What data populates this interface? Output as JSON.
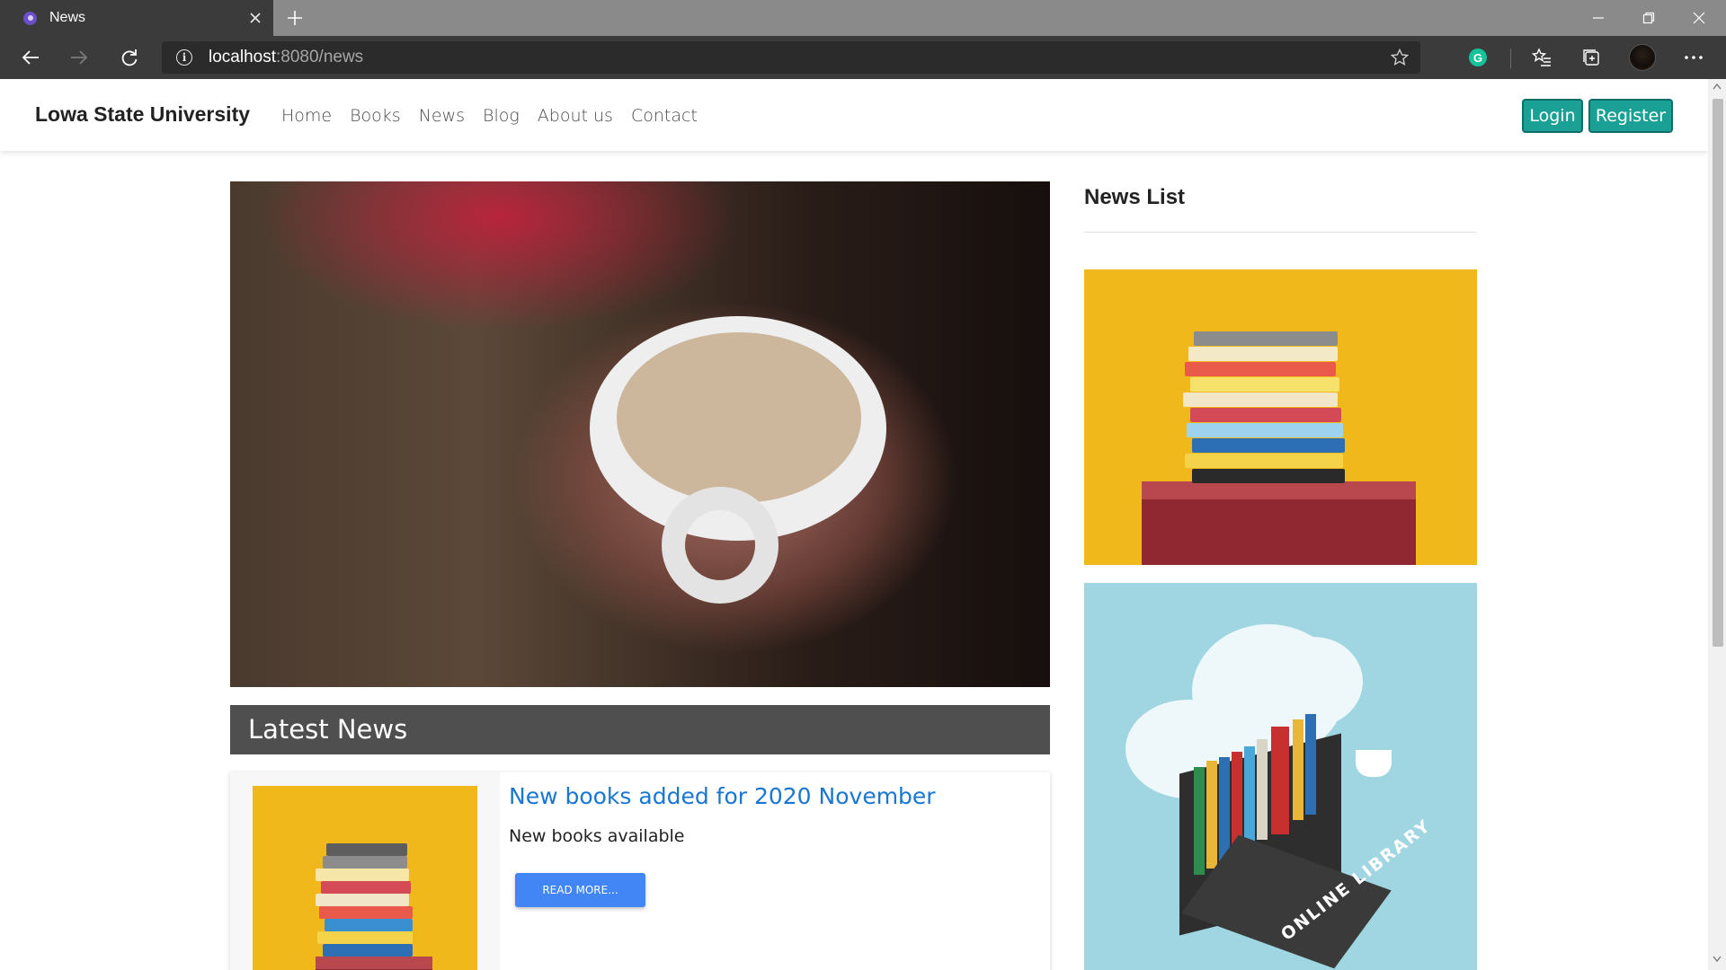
{
  "browser": {
    "tab_title": "News",
    "url_host": "localhost",
    "url_path": ":8080/news"
  },
  "site": {
    "brand": "Lowa State University",
    "menu": [
      "Home",
      "Books",
      "News",
      "Blog",
      "About us",
      "Contact"
    ],
    "login_label": "Login",
    "register_label": "Register"
  },
  "main": {
    "latest_heading": "Latest News",
    "articles": [
      {
        "headline": "New books added for 2020 November",
        "summary": "New books available",
        "read_more": "READ MORE..."
      }
    ]
  },
  "sidebar": {
    "title": "News List",
    "image2_caption": "ONLINE LIBRARY"
  },
  "colors": {
    "accent_teal": "#1aa095",
    "link_blue": "#1976d2",
    "button_blue": "#4285f4",
    "header_gray": "#4f4f4f"
  }
}
